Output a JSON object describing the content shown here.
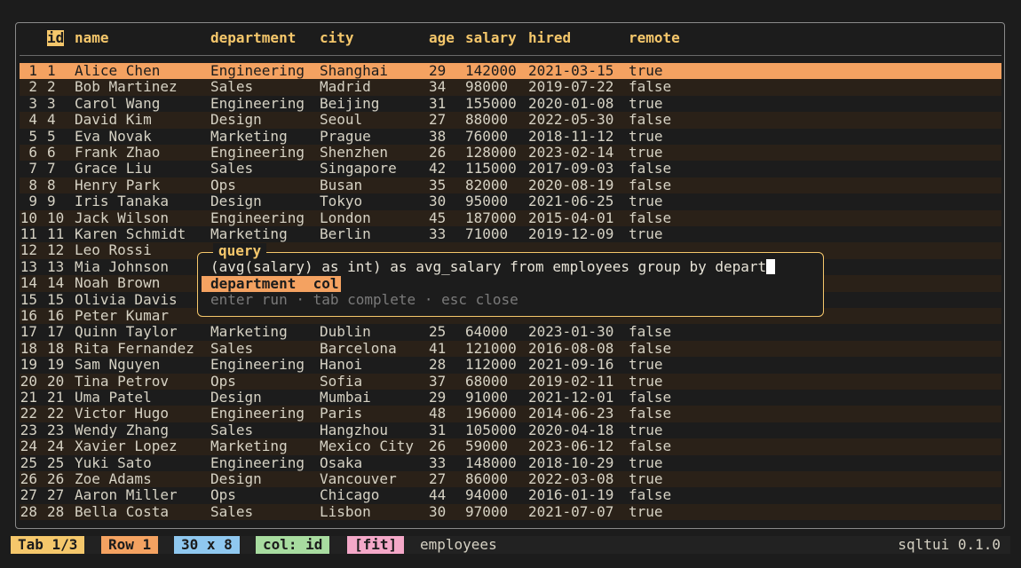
{
  "columns": [
    "id",
    "name",
    "department",
    "city",
    "age",
    "salary",
    "hired",
    "remote"
  ],
  "rows": [
    [
      "1",
      "1",
      "Alice Chen",
      "Engineering",
      "Shanghai",
      "29",
      "142000",
      "2021-03-15",
      "true"
    ],
    [
      "2",
      "2",
      "Bob Martinez",
      "Sales",
      "Madrid",
      "34",
      "98000",
      "2019-07-22",
      "false"
    ],
    [
      "3",
      "3",
      "Carol Wang",
      "Engineering",
      "Beijing",
      "31",
      "155000",
      "2020-01-08",
      "true"
    ],
    [
      "4",
      "4",
      "David Kim",
      "Design",
      "Seoul",
      "27",
      "88000",
      "2022-05-30",
      "false"
    ],
    [
      "5",
      "5",
      "Eva Novak",
      "Marketing",
      "Prague",
      "38",
      "76000",
      "2018-11-12",
      "true"
    ],
    [
      "6",
      "6",
      "Frank Zhao",
      "Engineering",
      "Shenzhen",
      "26",
      "128000",
      "2023-02-14",
      "true"
    ],
    [
      "7",
      "7",
      "Grace Liu",
      "Sales",
      "Singapore",
      "42",
      "115000",
      "2017-09-03",
      "false"
    ],
    [
      "8",
      "8",
      "Henry Park",
      "Ops",
      "Busan",
      "35",
      "82000",
      "2020-08-19",
      "false"
    ],
    [
      "9",
      "9",
      "Iris Tanaka",
      "Design",
      "Tokyo",
      "30",
      "95000",
      "2021-06-25",
      "true"
    ],
    [
      "10",
      "10",
      "Jack Wilson",
      "Engineering",
      "London",
      "45",
      "187000",
      "2015-04-01",
      "false"
    ],
    [
      "11",
      "11",
      "Karen Schmidt",
      "Marketing",
      "Berlin",
      "33",
      "71000",
      "2019-12-09",
      "true"
    ],
    [
      "12",
      "12",
      "Leo Rossi",
      "",
      "",
      "",
      "",
      "",
      ""
    ],
    [
      "13",
      "13",
      "Mia Johnson",
      "",
      "",
      "",
      "",
      "",
      ""
    ],
    [
      "14",
      "14",
      "Noah Brown",
      "",
      "",
      "",
      "",
      "",
      ""
    ],
    [
      "15",
      "15",
      "Olivia Davis",
      "",
      "",
      "",
      "",
      "",
      ""
    ],
    [
      "16",
      "16",
      "Peter Kumar",
      "",
      "",
      "",
      "",
      "",
      ""
    ],
    [
      "17",
      "17",
      "Quinn Taylor",
      "Marketing",
      "Dublin",
      "25",
      "64000",
      "2023-01-30",
      "false"
    ],
    [
      "18",
      "18",
      "Rita Fernandez",
      "Sales",
      "Barcelona",
      "41",
      "121000",
      "2016-08-08",
      "false"
    ],
    [
      "19",
      "19",
      "Sam Nguyen",
      "Engineering",
      "Hanoi",
      "28",
      "112000",
      "2021-09-16",
      "true"
    ],
    [
      "20",
      "20",
      "Tina Petrov",
      "Ops",
      "Sofia",
      "37",
      "68000",
      "2019-02-11",
      "true"
    ],
    [
      "21",
      "21",
      "Uma Patel",
      "Design",
      "Mumbai",
      "29",
      "91000",
      "2021-12-01",
      "false"
    ],
    [
      "22",
      "22",
      "Victor Hugo",
      "Engineering",
      "Paris",
      "48",
      "196000",
      "2014-06-23",
      "false"
    ],
    [
      "23",
      "23",
      "Wendy Zhang",
      "Sales",
      "Hangzhou",
      "31",
      "105000",
      "2020-04-18",
      "true"
    ],
    [
      "24",
      "24",
      "Xavier Lopez",
      "Marketing",
      "Mexico City",
      "26",
      "59000",
      "2023-06-12",
      "false"
    ],
    [
      "25",
      "25",
      "Yuki Sato",
      "Engineering",
      "Osaka",
      "33",
      "148000",
      "2018-10-29",
      "true"
    ],
    [
      "26",
      "26",
      "Zoe Adams",
      "Design",
      "Vancouver",
      "27",
      "86000",
      "2022-03-08",
      "true"
    ],
    [
      "27",
      "27",
      "Aaron Miller",
      "Ops",
      "Chicago",
      "44",
      "94000",
      "2016-01-19",
      "false"
    ],
    [
      "28",
      "28",
      "Bella Costa",
      "Sales",
      "Lisbon",
      "30",
      "97000",
      "2021-07-07",
      "true"
    ]
  ],
  "query_modal": {
    "title": "query",
    "text": "(avg(salary) as int) as avg_salary from employees group by depart",
    "suggestion": "department  col",
    "hint": "enter run · tab complete · esc close"
  },
  "status": {
    "tab": "Tab 1/3",
    "row": "Row 1",
    "dims": "30 x 8",
    "col": "col: id",
    "fit": "[fit]",
    "table": "employees",
    "version": "sqltui 0.1.0"
  },
  "colors": {
    "accent": "#f5c76b",
    "selected_row": "#f4a261",
    "tab_badge": "#f5c76b",
    "row_badge": "#f4a261",
    "dims_badge": "#8fc8f0",
    "col_badge": "#a8dca0",
    "fit_badge": "#f4a8c8"
  }
}
